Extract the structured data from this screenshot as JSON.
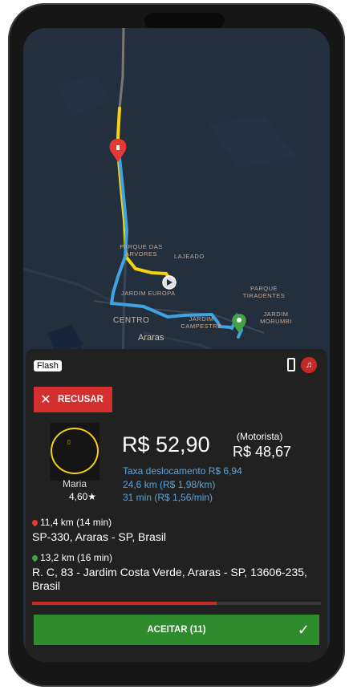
{
  "map": {
    "labels": {
      "parque_das_arvores": "PARQUE DAS ÁRVORES",
      "lajeado": "LAJEADO",
      "parque_tiradentes": "PARQUE TIRADENTES",
      "jardim_europa": "JARDIM EUROPA",
      "jardim_morumbi": "JARDIM MORUMBI",
      "centro": "CENTRO",
      "jardim_campestre": "JARDIM CAMPESTRE",
      "araras": "Araras"
    },
    "colors": {
      "route_pickup": "#f5d20c",
      "route_trip": "#3ea3e0",
      "origin_pin": "#e53935",
      "dest_pin": "#43a047"
    }
  },
  "header": {
    "service_badge": "Flash",
    "phone_icon": "phone-icon",
    "no_music_icon": "no-music-icon"
  },
  "actions": {
    "decline_label": "RECUSAR",
    "accept_label": "ACEITAR (11)"
  },
  "passenger": {
    "name": "Maria",
    "rating": "4,60★"
  },
  "fare": {
    "price": "R$ 52,90",
    "driver_label": "(Motorista)",
    "driver_value": "R$ 48,67",
    "displacement_fee": "Taxa deslocamento R$ 6,94",
    "distance_rate": "24,6 km (R$ 1,98/km)",
    "time_rate": "31 min (R$ 1,56/min)"
  },
  "pickup": {
    "distance": "11,4 km (14 min)",
    "address": "SP-330, Araras - SP, Brasil"
  },
  "destination": {
    "distance": "13,2 km (16 min)",
    "address": "R. C, 83 - Jardim Costa Verde, Araras - SP, 13606-235, Brasil"
  },
  "countdown": {
    "remaining_fraction": 0.64
  }
}
